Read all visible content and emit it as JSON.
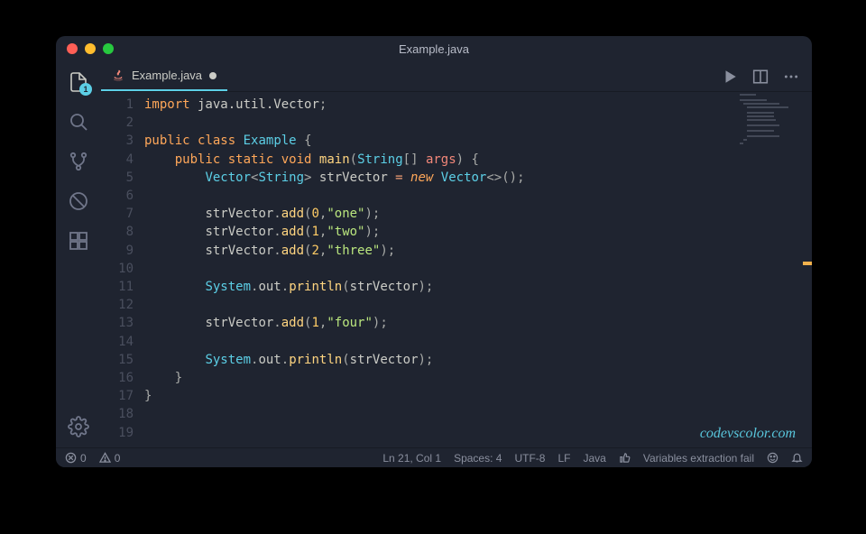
{
  "title": "Example.java",
  "activity": {
    "explorer_badge": "1"
  },
  "tab": {
    "label": "Example.java"
  },
  "gutter": {
    "lines": [
      "1",
      "2",
      "3",
      "4",
      "5",
      "6",
      "7",
      "8",
      "9",
      "10",
      "11",
      "12",
      "13",
      "14",
      "15",
      "16",
      "17",
      "18",
      "19"
    ]
  },
  "code": {
    "l1_kw": "import",
    "l1_pkg": " java.util.Vector",
    "l1_end": ";",
    "l3_kw1": "public",
    "l3_kw2": "class",
    "l3_cls": "Example",
    "l3_br": "{",
    "l4_kw1": "public",
    "l4_kw2": "static",
    "l4_kw3": "void",
    "l4_fn": "main",
    "l4_type": "String",
    "l4_arr": "[] ",
    "l4_arg": "args",
    "l4_br": "{",
    "l5_type": "Vector",
    "l5_gen": "String",
    "l5_var": "strVector",
    "l5_eq": " = ",
    "l5_new": "new",
    "l5_ctor": "Vector",
    "l5_diamond": "<>",
    "l5_call": "();",
    "l7_obj": "strVector",
    "l7_dot": ".",
    "l7_fn": "add",
    "l7_idx": "0",
    "l7_comma": ",",
    "l7_str": "\"one\"",
    "l7_end": ");",
    "l8_obj": "strVector",
    "l8_fn": "add",
    "l8_idx": "1",
    "l8_str": "\"two\"",
    "l9_obj": "strVector",
    "l9_fn": "add",
    "l9_idx": "2",
    "l9_str": "\"three\"",
    "l11_sys": "System",
    "l11_out": "out",
    "l11_fn": "println",
    "l11_arg": "strVector",
    "l13_obj": "strVector",
    "l13_fn": "add",
    "l13_idx": "1",
    "l13_str": "\"four\"",
    "l15_sys": "System",
    "l15_out": "out",
    "l15_fn": "println",
    "l15_arg": "strVector",
    "l16_br": "}",
    "l17_br": "}",
    "indent1": "    ",
    "indent2": "        ",
    "indent3": "            "
  },
  "watermark": "codevscolor.com",
  "status": {
    "errors": "0",
    "warnings": "0",
    "cursor": "Ln 21, Col 1",
    "spaces": "Spaces: 4",
    "encoding": "UTF-8",
    "eol": "LF",
    "lang": "Java",
    "msg": "Variables extraction fail"
  }
}
